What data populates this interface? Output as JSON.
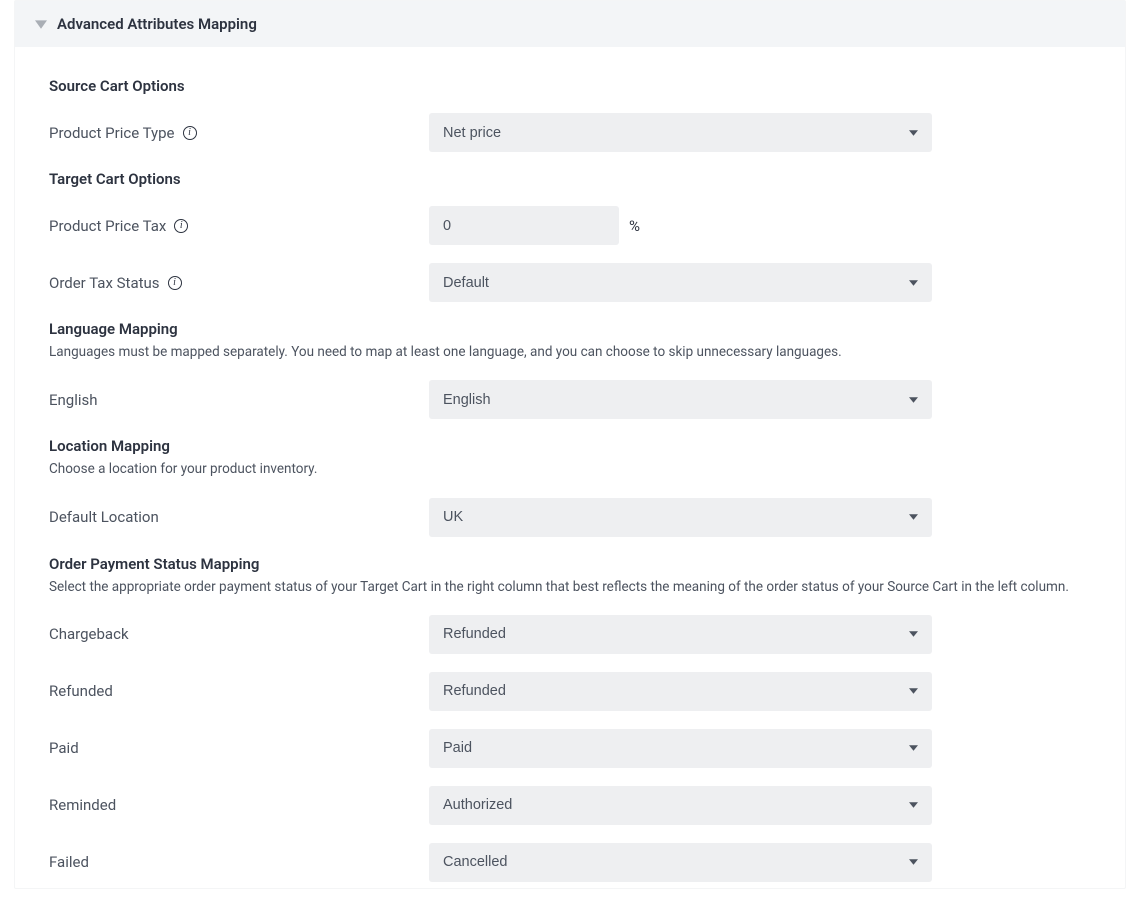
{
  "header": {
    "title": "Advanced Attributes Mapping"
  },
  "sourceCart": {
    "title": "Source Cart Options",
    "productPriceType": {
      "label": "Product Price Type",
      "value": "Net price"
    }
  },
  "targetCart": {
    "title": "Target Cart Options",
    "productPriceTax": {
      "label": "Product Price Tax",
      "value": "0",
      "unit": "%"
    },
    "orderTaxStatus": {
      "label": "Order Tax Status",
      "value": "Default"
    }
  },
  "languageMapping": {
    "title": "Language Mapping",
    "desc": "Languages must be mapped separately. You need to map at least one language, and you can choose to skip unnecessary languages.",
    "items": [
      {
        "label": "English",
        "value": "English"
      }
    ]
  },
  "locationMapping": {
    "title": "Location Mapping",
    "desc": "Choose a location for your product inventory.",
    "defaultLocation": {
      "label": "Default Location",
      "value": "UK"
    }
  },
  "orderPaymentStatus": {
    "title": "Order Payment Status Mapping",
    "desc": "Select the appropriate order payment status of your Target Cart in the right column that best reflects the meaning of the order status of your Source Cart in the left column.",
    "items": [
      {
        "label": "Chargeback",
        "value": "Refunded"
      },
      {
        "label": "Refunded",
        "value": "Refunded"
      },
      {
        "label": "Paid",
        "value": "Paid"
      },
      {
        "label": "Reminded",
        "value": "Authorized"
      },
      {
        "label": "Failed",
        "value": "Cancelled"
      }
    ]
  }
}
